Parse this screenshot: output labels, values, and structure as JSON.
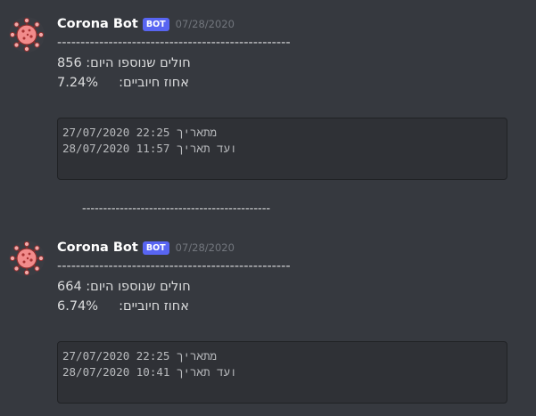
{
  "messages": [
    {
      "username": "Corona Bot",
      "bot_tag": "BOT",
      "timestamp": "07/28/2020",
      "divider": "--------------------------------------------------",
      "line1": "חולים שנוספו היום: 856",
      "line2": "אחוז חיוביים:     7.24%",
      "code_from": "27/07/2020 22:25 מתאריך",
      "code_to": "28/07/2020 11:57 ועד תאריך"
    },
    {
      "username": "Corona Bot",
      "bot_tag": "BOT",
      "timestamp": "07/28/2020",
      "divider": "--------------------------------------------------",
      "line1": "חולים שנוספו היום: 664",
      "line2": "אחוז חיוביים:     6.74%",
      "code_from": "27/07/2020 22:25 מתאריך",
      "code_to": "28/07/2020 10:41 ועד תאריך"
    }
  ],
  "separator": "---------------------------------------------",
  "icons": {
    "avatar": "virus-avatar-icon"
  },
  "colors": {
    "bot_tag": "#5865f2",
    "background": "#36393f",
    "codeblock": "#2f3136"
  }
}
